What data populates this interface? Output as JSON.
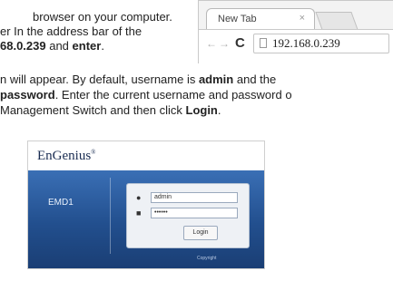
{
  "instructions": {
    "line1": "browser on your computer.",
    "line2": "er In the address bar of the",
    "line3_bold": "68.0.239",
    "line3_mid": " and ",
    "line3_bold2": "enter",
    "line3_end": ".",
    "line4_pre": "n will appear. By default, username is ",
    "line4_bold": "admin",
    "line4_post": " and the",
    "line5_bold": "password",
    "line5_post": ". Enter the current username and password o",
    "line6_pre": " Management Switch and then click ",
    "line6_bold": "Login",
    "line6_end": "."
  },
  "browser": {
    "tab_title": "New Tab",
    "tab_close": "×",
    "address": "192.168.0.239"
  },
  "login_screen": {
    "logo": "EnGenius",
    "logo_mark": "®",
    "device_name": "EMD1",
    "username_value": "admin",
    "password_value": "••••••",
    "login_button": "Login",
    "footer_text": "Copyright"
  },
  "colors": {
    "panel_blue": "#224f8e",
    "logo_navy": "#1a2d52"
  }
}
